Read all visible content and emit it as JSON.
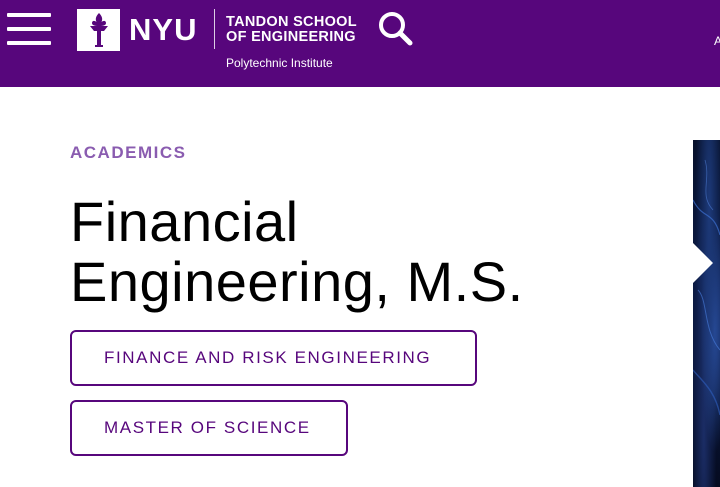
{
  "header": {
    "brand": "NYU",
    "school_line1": "TANDON SCHOOL",
    "school_line2": "OF ENGINEERING",
    "subtitle": "Polytechnic Institute",
    "edge_text": "A",
    "colors": {
      "background": "#57067c",
      "text": "#ffffff"
    },
    "icons": {
      "menu": "hamburger-menu-icon",
      "logo": "torch-icon",
      "search": "search-icon"
    }
  },
  "main": {
    "eyebrow": "ACADEMICS",
    "title_line1": "Financial",
    "title_line2": "Engineering, M.S.",
    "tags": [
      {
        "label": "FINANCE AND RISK ENGINEERING"
      },
      {
        "label": "MASTER OF SCIENCE"
      }
    ],
    "colors": {
      "eyebrow": "#8a5cb0",
      "tag_border": "#57067c",
      "tag_text": "#57067c",
      "title": "#000000"
    }
  },
  "hero": {
    "media": "abstract-blue-light-image",
    "control": "slide-arrow"
  }
}
